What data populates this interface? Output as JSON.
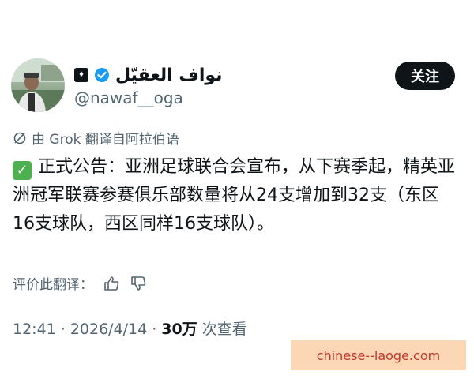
{
  "author": {
    "display_name": "نواف العقيّل",
    "handle": "@nawaf__oga",
    "affiliate_icon": "badge-icon"
  },
  "follow_button": {
    "label": "关注"
  },
  "translation": {
    "note": "由 Grok 翻译自阿拉伯语",
    "rate_label": "评价此翻译："
  },
  "tweet": {
    "emoji": "✓",
    "text": "正式公告：亚洲足球联合会宣布，从下赛季起，精英亚洲冠军联赛参赛俱乐部数量将从24支增加到32支（东区16支球队，西区同样16支球队）。"
  },
  "meta": {
    "time": "12:41",
    "separator": "·",
    "date": "2026/4/14",
    "views_count": "30万",
    "views_label": "次查看"
  },
  "watermark": {
    "text": "chinese--laoge.com"
  },
  "colors": {
    "text": "#0f1419",
    "muted": "#536471",
    "verified": "#1d9bf0",
    "watermark_bg": "#fbd7b6",
    "watermark_text": "#c0392b"
  }
}
